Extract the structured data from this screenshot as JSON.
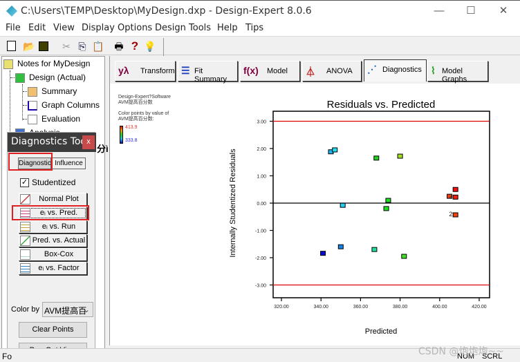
{
  "window": {
    "title": "C:\\Users\\TEMP\\Desktop\\MyDesign.dxp - Design-Expert 8.0.6",
    "controls": {
      "minimize": "—",
      "maximize": "☐",
      "close": "✕"
    }
  },
  "menu": [
    "File",
    "Edit",
    "View",
    "Display Options",
    "Design Tools",
    "Help",
    "Tips"
  ],
  "toolbar": {
    "icons": [
      {
        "name": "new-icon",
        "glyph": "🗋"
      },
      {
        "name": "open-icon",
        "glyph": "📂"
      },
      {
        "name": "save-icon",
        "glyph": "💾"
      },
      {
        "name": "cut-icon",
        "glyph": "✂"
      },
      {
        "name": "copy-icon",
        "glyph": "⎘"
      },
      {
        "name": "paste-icon",
        "glyph": "📋"
      },
      {
        "name": "print-icon",
        "glyph": "🖶"
      },
      {
        "name": "help-icon",
        "glyph": "?"
      },
      {
        "name": "tip-icon",
        "glyph": "💡"
      }
    ]
  },
  "tree": {
    "root": "Notes for MyDesign",
    "design": "Design (Actual)",
    "children": [
      "Summary",
      "Graph Columns",
      "Evaluation"
    ],
    "analysis": "Analysis"
  },
  "diagnostics_tool": {
    "title": "Diagnostics Tool",
    "close": "x",
    "tabs": [
      "Diagnostics",
      "Influence"
    ],
    "studentized_label": "Studentized",
    "studentized_checked": "✓",
    "plot_buttons": [
      "Normal Plot",
      "eᵢ vs. Pred.",
      "eᵢ vs. Run",
      "Pred. vs. Actual",
      "Box-Cox",
      "eᵢ vs. Factor"
    ],
    "selected_plot": "eᵢ vs. Pred.",
    "color_by_label": "Color by",
    "color_by_value": "AVM提高百",
    "clear_points": "Clear Points",
    "pop_out_view": "Pop-Out View",
    "peek_text": "分ì"
  },
  "tabs": [
    {
      "label": "Transform",
      "icon": "yλ"
    },
    {
      "label": "Fit Summary",
      "icon": "☰"
    },
    {
      "label": "Model",
      "icon": "f(x)"
    },
    {
      "label": "ANOVA",
      "icon": "⏃"
    },
    {
      "label": "Diagnostics",
      "icon": "⋰"
    },
    {
      "label": "Model Graphs",
      "icon": "⌇"
    }
  ],
  "active_tab": "Diagnostics",
  "graph_info": {
    "line1": "Design-Expert?Software",
    "line2": "AVM提高百分数",
    "line3": "Color points by value of",
    "line4": "AVM提高百分数:",
    "legend_max": "413.9",
    "legend_min": "333.8"
  },
  "chart_data": {
    "type": "scatter",
    "title": "Residuals vs. Predicted",
    "xlabel": "Predicted",
    "ylabel": "Internally Studentized Residuals",
    "xlim": [
      312,
      428
    ],
    "ylim": [
      -3.4,
      3.4
    ],
    "xticks": [
      "320.00",
      "340.00",
      "360.00",
      "380.00",
      "400.00",
      "420.00"
    ],
    "xtick_values": [
      320,
      340,
      360,
      380,
      400,
      420
    ],
    "yticks": [
      "3.00",
      "2.00",
      "1.00",
      "0.00",
      "-1.00",
      "-2.00",
      "-3.00"
    ],
    "ytick_values": [
      3,
      2,
      1,
      0,
      -1,
      -2,
      -3
    ],
    "reference_lines": [
      {
        "y": 3.0,
        "color": "#e00000"
      },
      {
        "y": 0.0,
        "color": "#000000"
      },
      {
        "y": -3.0,
        "color": "#e00000"
      }
    ],
    "points": [
      {
        "x": 341,
        "y": -1.84,
        "color": "#0a0ad0"
      },
      {
        "x": 345,
        "y": 1.88,
        "color": "#20b0f0"
      },
      {
        "x": 347,
        "y": 1.95,
        "color": "#20e0f0"
      },
      {
        "x": 350,
        "y": -1.6,
        "color": "#1880e0"
      },
      {
        "x": 351,
        "y": -0.08,
        "color": "#20d0f0"
      },
      {
        "x": 367,
        "y": -1.7,
        "color": "#20e0a0"
      },
      {
        "x": 368,
        "y": 1.65,
        "color": "#20d020"
      },
      {
        "x": 373,
        "y": -0.2,
        "color": "#20e020"
      },
      {
        "x": 374,
        "y": 0.1,
        "color": "#20e020"
      },
      {
        "x": 380,
        "y": 1.72,
        "color": "#a0e020"
      },
      {
        "x": 382,
        "y": -1.95,
        "color": "#40e020"
      },
      {
        "x": 405,
        "y": 0.25,
        "color": "#f04010"
      },
      {
        "x": 408,
        "y": 0.5,
        "color": "#f01010"
      },
      {
        "x": 408,
        "y": 0.22,
        "color": "#f02010"
      },
      {
        "x": 408,
        "y": -0.43,
        "color": "#f04010"
      }
    ],
    "annotations": [
      {
        "x": 406.5,
        "y": 0.25,
        "text": "2"
      },
      {
        "x": 406.5,
        "y": -0.4,
        "text": "2"
      }
    ],
    "grid": false
  },
  "status": {
    "left": "Fo",
    "num": "NUM",
    "scrl": "SCRL"
  },
  "watermark": "CSDN @炮炮炮~~"
}
